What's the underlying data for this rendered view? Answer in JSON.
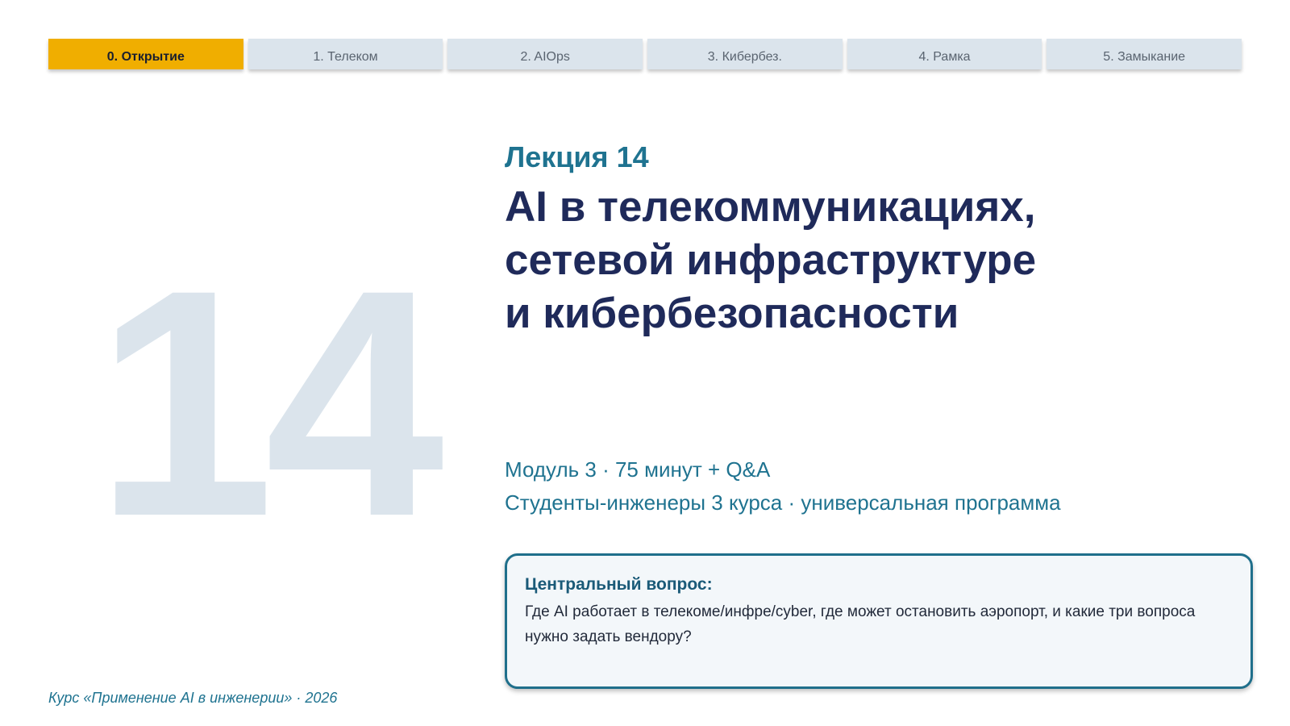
{
  "nav": {
    "tabs": [
      {
        "label": "0. Открытие",
        "active": true
      },
      {
        "label": "1. Телеком",
        "active": false
      },
      {
        "label": "2. AIOps",
        "active": false
      },
      {
        "label": "3. Кибербез.",
        "active": false
      },
      {
        "label": "4. Рамка",
        "active": false
      },
      {
        "label": "5. Замыкание",
        "active": false
      }
    ]
  },
  "slide": {
    "big_number": "14",
    "lecture_label": "Лекция 14",
    "title_lines": [
      "AI в телекоммуникациях,",
      "сетевой инфраструктуре",
      "и кибербезопасности"
    ],
    "meta_lines": [
      "Модуль 3 · 75 минут + Q&A",
      "Студенты-инженеры 3 курса · универсальная программа"
    ],
    "question": {
      "label": "Центральный вопрос:",
      "text": "Где AI работает в телекоме/инфре/cyber, где может остановить аэропорт, и какие три вопроса нужно задать вендору?"
    },
    "footer": "Курс «Применение AI в инженерии» · 2026"
  },
  "colors": {
    "accent_tab": "#f0ae00",
    "inactive_tab": "#dbe4ec",
    "title": "#1f2a5a",
    "teal": "#1f7390",
    "big_number": "#dbe4ec"
  }
}
